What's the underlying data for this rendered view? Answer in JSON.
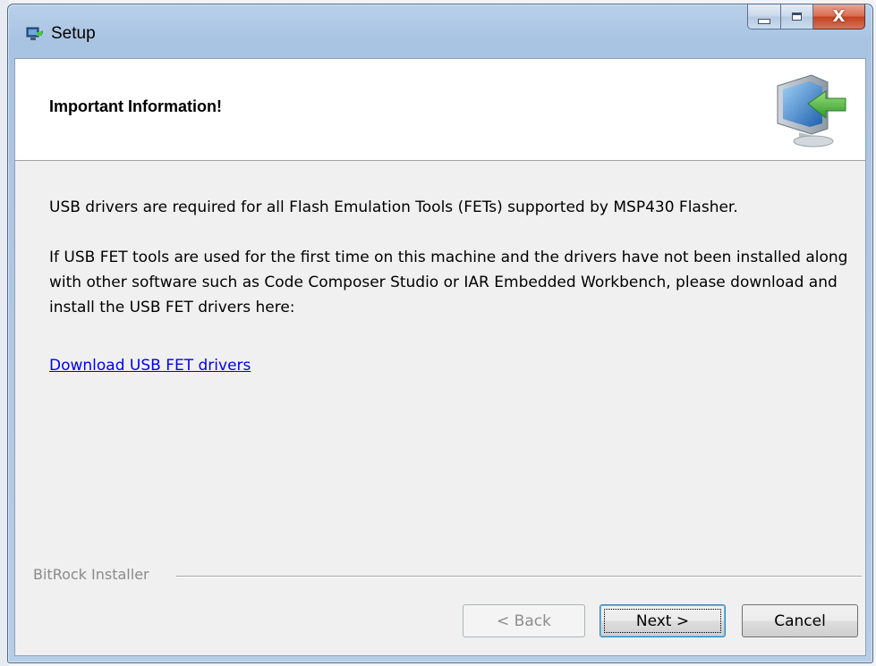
{
  "window": {
    "title": "Setup"
  },
  "caption_buttons": {
    "close_glyph": "X"
  },
  "header": {
    "title": "Important Information!",
    "graphic_icon": "computer-arrow-icon"
  },
  "body": {
    "paragraph1": "USB drivers are required for all Flash Emulation Tools (FETs) supported by MSP430 Flasher.",
    "paragraph2": "If USB FET tools are used for the first time on this machine and the drivers have not been installed along with other software such as Code Composer Studio or IAR Embedded Workbench, please download and install the USB FET drivers here:",
    "link_text": "Download USB FET drivers"
  },
  "footer": {
    "brand": "BitRock Installer",
    "back_label": "< Back",
    "next_label": "Next >",
    "cancel_label": "Cancel"
  },
  "colors": {
    "link": "#0000ee",
    "disabled_text": "#8d8d8d",
    "close_button": "#c4401e"
  }
}
